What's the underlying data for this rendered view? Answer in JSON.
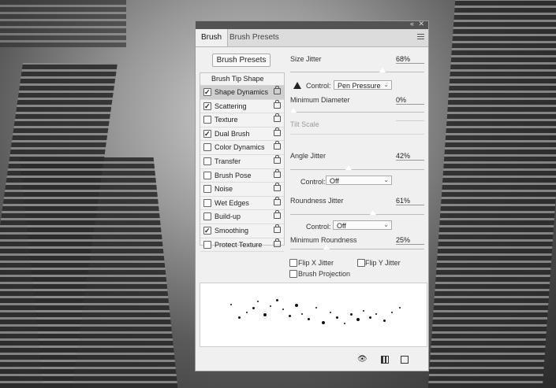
{
  "panel": {
    "tabs": [
      {
        "label": "Brush"
      },
      {
        "label": "Brush Presets"
      }
    ],
    "presets_button": "Brush Presets",
    "list_title": "Brush Tip Shape",
    "items": [
      {
        "label": "Shape Dynamics",
        "checked": true,
        "selected": true
      },
      {
        "label": "Scattering",
        "checked": true
      },
      {
        "label": "Texture",
        "checked": false
      },
      {
        "label": "Dual Brush",
        "checked": true
      },
      {
        "label": "Color Dynamics",
        "checked": false
      },
      {
        "label": "Transfer",
        "checked": false
      },
      {
        "label": "Brush Pose",
        "checked": false
      },
      {
        "label": "Noise",
        "checked": false
      },
      {
        "label": "Wet Edges",
        "checked": false
      },
      {
        "label": "Build-up",
        "checked": false
      },
      {
        "label": "Smoothing",
        "checked": true
      },
      {
        "label": "Protect Texture",
        "checked": false
      }
    ],
    "size_jitter": {
      "label": "Size Jitter",
      "value": "68%",
      "fraction": 0.68
    },
    "control1": {
      "label": "Control:",
      "value": "Pen Pressure"
    },
    "min_diameter": {
      "label": "Minimum Diameter",
      "value": "0%",
      "fraction": 0.0
    },
    "tilt_scale": {
      "label": "Tilt Scale"
    },
    "angle_jitter": {
      "label": "Angle Jitter",
      "value": "42%",
      "fraction": 0.42
    },
    "control2": {
      "label": "Control:",
      "value": "Off"
    },
    "roundness_jitter": {
      "label": "Roundness Jitter",
      "value": "61%",
      "fraction": 0.61
    },
    "control3": {
      "label": "Control:",
      "value": "Off"
    },
    "min_roundness": {
      "label": "Minimum Roundness",
      "value": "25%",
      "fraction": 0.25
    },
    "flip_x": {
      "label": "Flip X Jitter",
      "checked": false
    },
    "flip_y": {
      "label": "Flip Y Jitter",
      "checked": false
    },
    "projection": {
      "label": "Brush Projection",
      "checked": false
    }
  }
}
